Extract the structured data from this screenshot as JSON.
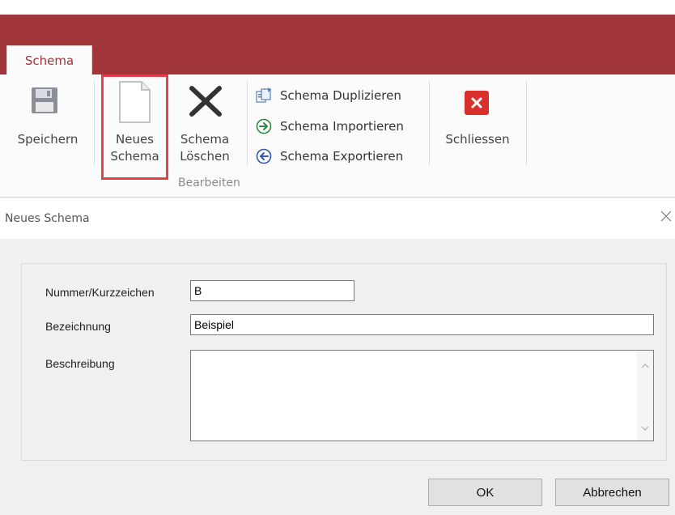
{
  "ribbon": {
    "tab": "Schema",
    "buttons": {
      "save": "Speichern",
      "new_line1": "Neues",
      "new_line2": "Schema",
      "delete_line1": "Schema",
      "delete_line2": "Löschen",
      "close": "Schliessen"
    },
    "edit_items": [
      "Schema Duplizieren",
      "Schema Importieren",
      "Schema Exportieren"
    ],
    "group_label": "Bearbeiten"
  },
  "dialog": {
    "title": "Neues Schema",
    "fields": {
      "number_label": "Nummer/Kurzzeichen",
      "number_value": "B",
      "name_label": "Bezeichnung",
      "name_value": "Beispiel",
      "description_label": "Beschreibung",
      "description_value": ""
    },
    "buttons": {
      "ok": "OK",
      "cancel": "Abbrechen"
    }
  },
  "colors": {
    "ribbon_accent": "#a0353a",
    "highlight_frame": "#e2414b",
    "close_red": "#d9302c"
  }
}
